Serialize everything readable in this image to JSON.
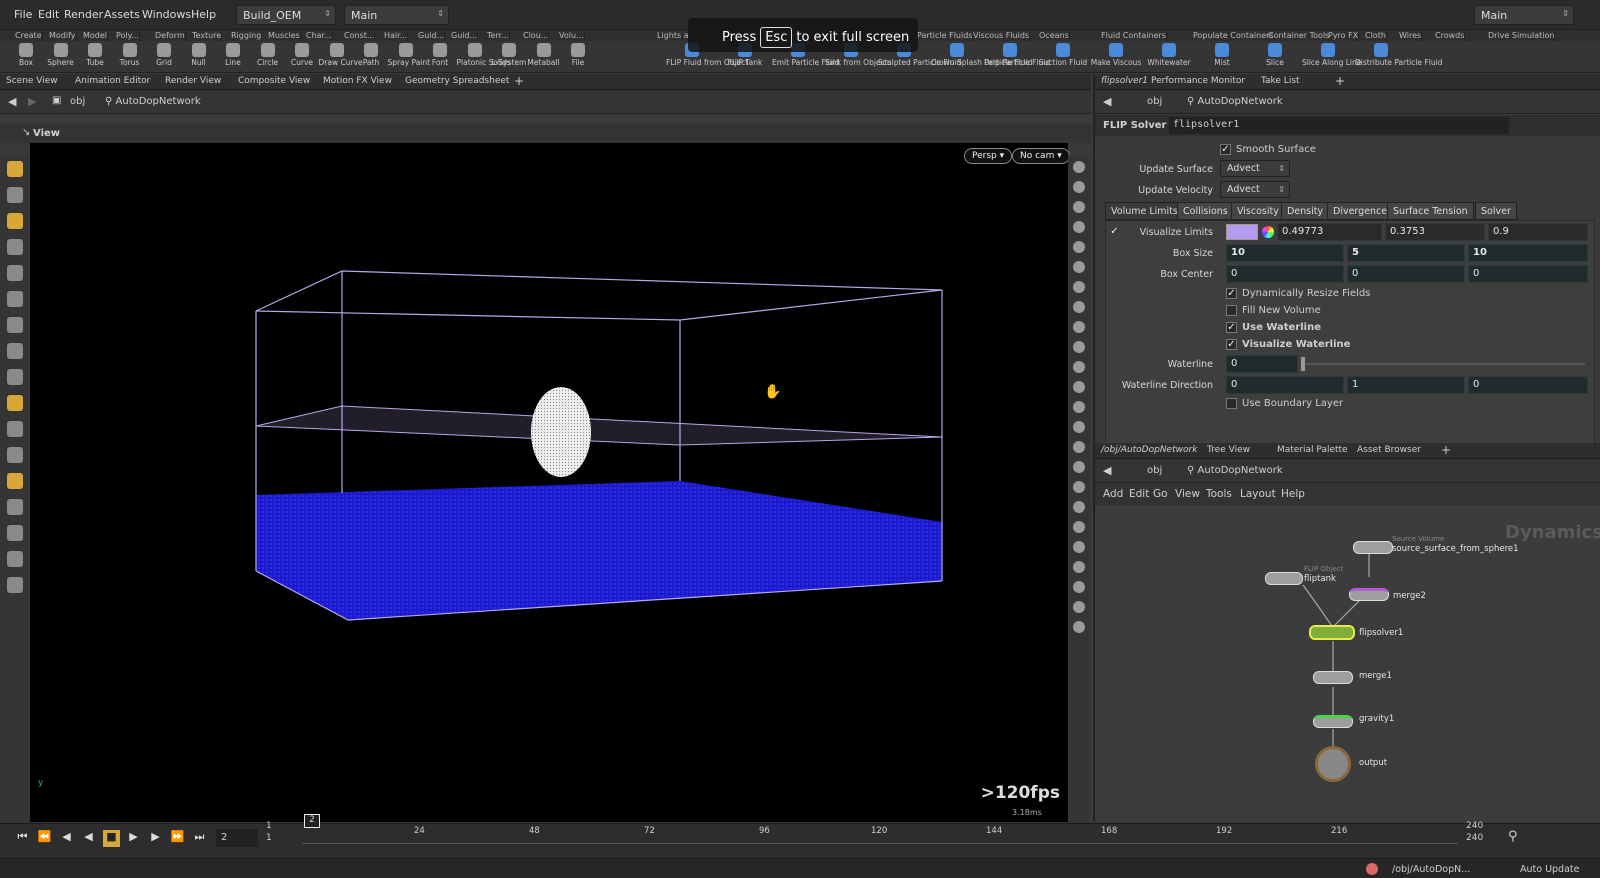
{
  "menubar": {
    "items": [
      "File",
      "Edit",
      "Render",
      "Assets",
      "Windows",
      "Help"
    ],
    "desktop": "Build_OEM",
    "context": "Main",
    "right_desktop": "Main"
  },
  "shelf_tabs": [
    "Create",
    "Modify",
    "Model",
    "Poly...",
    "Deform",
    "Texture",
    "Rigging",
    "Muscles",
    "Char...",
    "Const...",
    "Hair...",
    "Guid...",
    "Guid...",
    "Terr...",
    "Clou...",
    "Volu...",
    "Lights a",
    "Particle Fluids",
    "Viscous Fluids",
    "Oceans",
    "Fluid Containers",
    "Populate Containers",
    "Container Tools",
    "Pyro FX",
    "Cloth",
    "Wires",
    "Crowds",
    "Drive Simulation"
  ],
  "shelf_tools_left": [
    "Box",
    "Sphere",
    "Tube",
    "Torus",
    "Grid",
    "Null",
    "Line",
    "Circle",
    "Curve",
    "Draw Curve",
    "Path",
    "Spray Paint",
    "Font",
    "Platonic Solids",
    "L-System",
    "Metaball",
    "File"
  ],
  "shelf_tools_right": [
    "FLIP Fluid from Object",
    "FLIP Tank",
    "Emit Particle Fluid",
    "Sink from Objects",
    "Sculpted Particle Fluid",
    "Crown Splash Particle Fluid",
    "Drip Particle Fluid",
    "Suction Fluid",
    "Make Viscous",
    "Whitewater",
    "Mist",
    "Slice",
    "Slice Along Line",
    "Distribute Particle Fluid"
  ],
  "esc_banner": {
    "pre": "Press",
    "key": "Esc",
    "post": "to exit full screen"
  },
  "left_pane": {
    "tabs": [
      "Scene View",
      "Animation Editor",
      "Render View",
      "Composite View",
      "Motion FX View",
      "Geometry Spreadsheet"
    ],
    "path_root": "obj",
    "path_node": "AutoDopNetwork",
    "view_label": "View",
    "persp": "Persp ▾",
    "cam": "No cam ▾",
    "fps": ">120fps",
    "ms": "3.18ms"
  },
  "param_pane": {
    "tabs": [
      "flipsolver1",
      "Performance Monitor",
      "Take List"
    ],
    "path_root": "obj",
    "path_node": "AutoDopNetwork",
    "node_type": "FLIP Solver",
    "node_name": "flipsolver1",
    "smooth_surface": "Smooth Surface",
    "update_surface_label": "Update Surface",
    "update_surface": "Advect",
    "update_velocity_label": "Update Velocity",
    "update_velocity": "Advect",
    "sub_tabs": [
      "Volume Limits",
      "Collisions",
      "Viscosity",
      "Density",
      "Divergence",
      "Surface Tension",
      "Solver"
    ],
    "visualize_limits_label": "Visualize Limits",
    "visualize_color": "#b59af0",
    "vis": [
      "0.49773",
      "0.3753",
      "0.9"
    ],
    "box_size_label": "Box Size",
    "box_size": [
      "10",
      "5",
      "10"
    ],
    "box_center_label": "Box Center",
    "box_center": [
      "0",
      "0",
      "0"
    ],
    "dyn_resize": "Dynamically Resize Fields",
    "fill_new": "Fill New Volume",
    "use_waterline": "Use Waterline",
    "vis_waterline": "Visualize Waterline",
    "waterline_label": "Waterline",
    "waterline": "0",
    "waterline_dir_label": "Waterline Direction",
    "waterline_dir": [
      "0",
      "1",
      "0"
    ],
    "boundary": "Use Boundary Layer"
  },
  "network_pane": {
    "tabs": [
      "/obj/AutoDopNetwork",
      "Tree View",
      "Material Palette",
      "Asset Browser"
    ],
    "path_root": "obj",
    "path_node": "AutoDopNetwork",
    "menu": [
      "Add",
      "Edit",
      "Go",
      "View",
      "Tools",
      "Layout",
      "Help"
    ],
    "watermark": "Dynamics",
    "nodes": [
      {
        "type": "Source Volume",
        "name": "source_surface_from_sphere1"
      },
      {
        "type": "FLIP Object",
        "name": "fliptank"
      },
      {
        "type": "",
        "name": "merge2"
      },
      {
        "type": "",
        "name": "flipsolver1"
      },
      {
        "type": "",
        "name": "merge1"
      },
      {
        "type": "",
        "name": "gravity1"
      },
      {
        "type": "",
        "name": "output"
      }
    ]
  },
  "timeline": {
    "frame": "2",
    "start": "1",
    "start2": "1",
    "ticks": [
      "24",
      "48",
      "72",
      "96",
      "120",
      "144",
      "168",
      "192",
      "216"
    ],
    "end": "240",
    "end2": "240"
  },
  "status": {
    "path": "/obj/AutoDopN...",
    "update": "Auto Update"
  },
  "colors": {
    "accent": "#d8a73a",
    "water": "#1a1acc",
    "grid": "#b9a7e8"
  }
}
